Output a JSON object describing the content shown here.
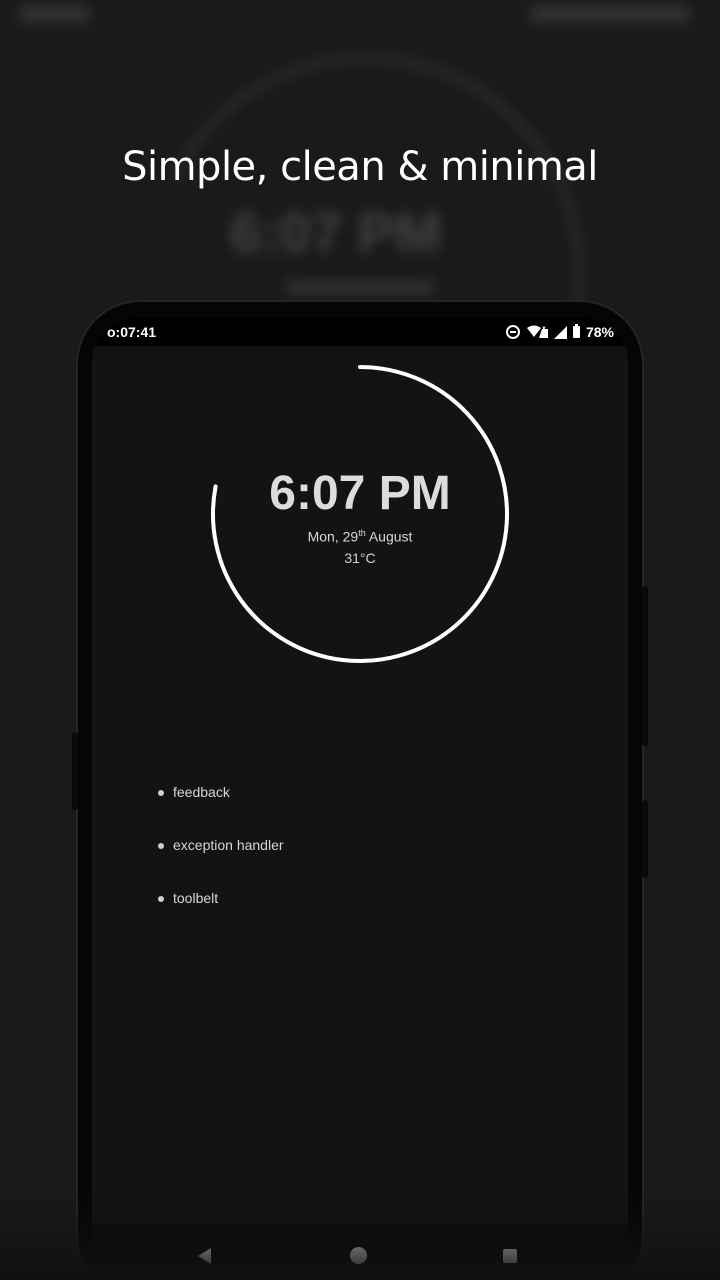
{
  "headline": "Simple, clean & minimal",
  "status_bar": {
    "time": "o:07:41",
    "battery": "78%",
    "icons": [
      "do-not-disturb-icon",
      "wifi-icon",
      "cellular-signal-icon",
      "cellular-signal-icon",
      "battery-icon"
    ]
  },
  "clock": {
    "time": "6:07 PM",
    "date_prefix": "Mon, 29",
    "date_suffix": "th",
    "date_month": " August",
    "temperature": "31°C",
    "ring_color": "#ffffff",
    "ring_progress": 0.78
  },
  "apps": [
    {
      "label": "feedback"
    },
    {
      "label": "exception handler"
    },
    {
      "label": "toolbelt"
    }
  ],
  "nav_bar": {
    "icons": [
      "back-icon",
      "home-icon",
      "recents-icon"
    ]
  },
  "colors": {
    "background": "#1a1a1a",
    "screen": "#131313",
    "text": "#dcdcdc"
  }
}
